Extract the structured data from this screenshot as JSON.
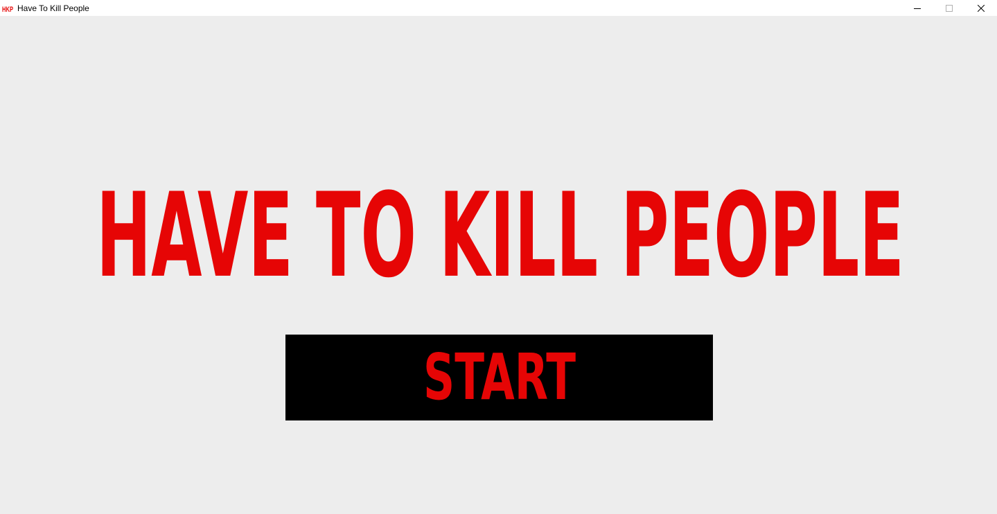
{
  "window": {
    "title": "Have To Kill People",
    "app_icon": "hkp-logo-icon",
    "controls": [
      "minimize-icon",
      "maximize-icon",
      "close-icon"
    ]
  },
  "main": {
    "title": "HAVE TO KILL PEOPLE",
    "start_label": "START"
  },
  "colors": {
    "accent": "#e60505",
    "background": "#ededed",
    "button_bg": "#000000"
  }
}
